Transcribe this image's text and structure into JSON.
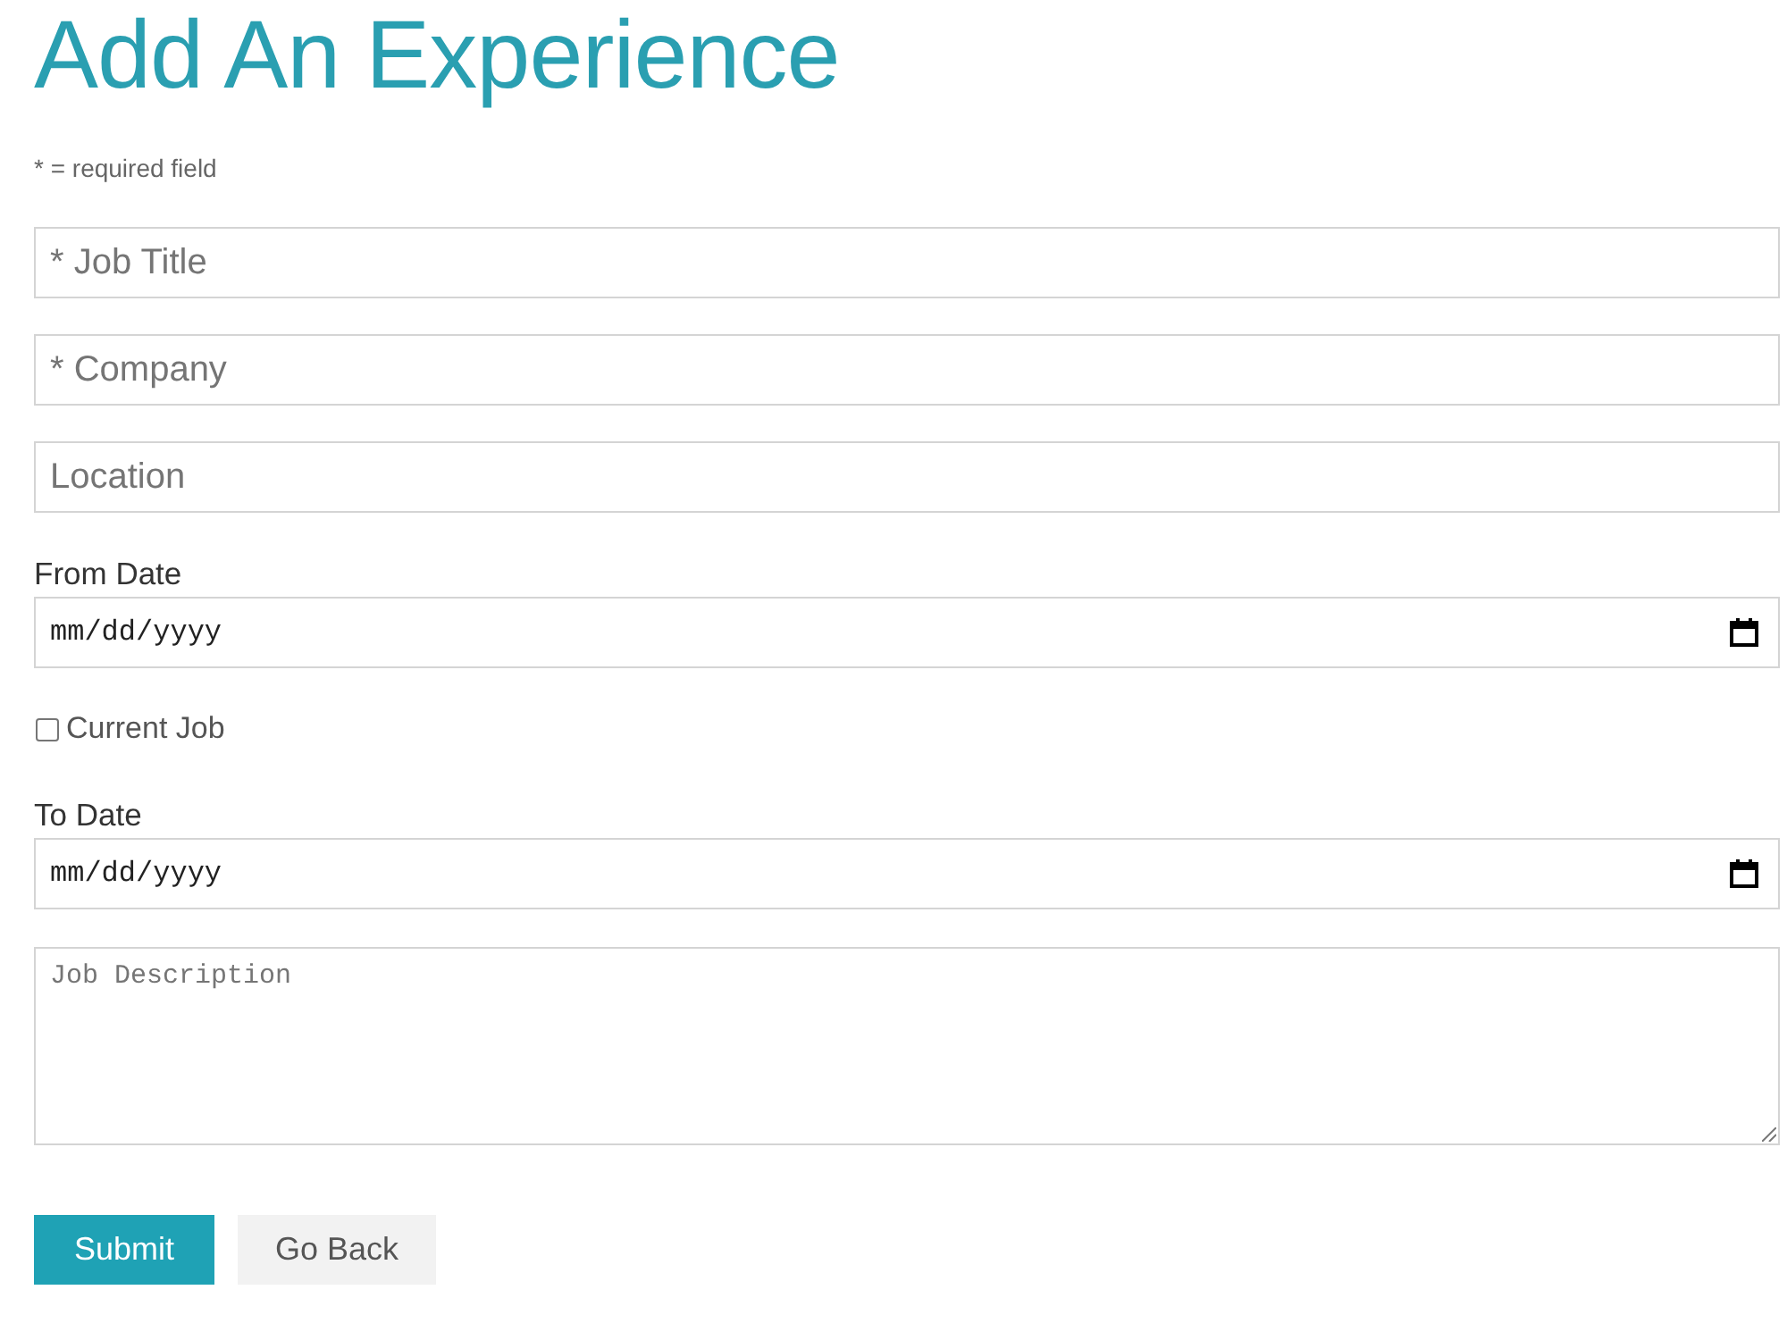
{
  "title": "Add An Experience",
  "required_note": "* = required field",
  "fields": [
    {
      "kind": "text",
      "placeholder": "* Job Title"
    },
    {
      "kind": "text",
      "placeholder": "* Company"
    },
    {
      "kind": "text",
      "placeholder": "Location"
    },
    {
      "kind": "date",
      "label": "From Date",
      "placeholder": "mm/dd/yyyy"
    },
    {
      "kind": "checkbox",
      "label": "Current Job",
      "checked": false
    },
    {
      "kind": "date",
      "label": "To Date",
      "placeholder": "mm/dd/yyyy"
    },
    {
      "kind": "textarea",
      "placeholder": "Job Description"
    }
  ],
  "buttons": [
    {
      "label": "Submit",
      "kind": "primary"
    },
    {
      "label": "Go Back",
      "kind": "secondary"
    }
  ]
}
